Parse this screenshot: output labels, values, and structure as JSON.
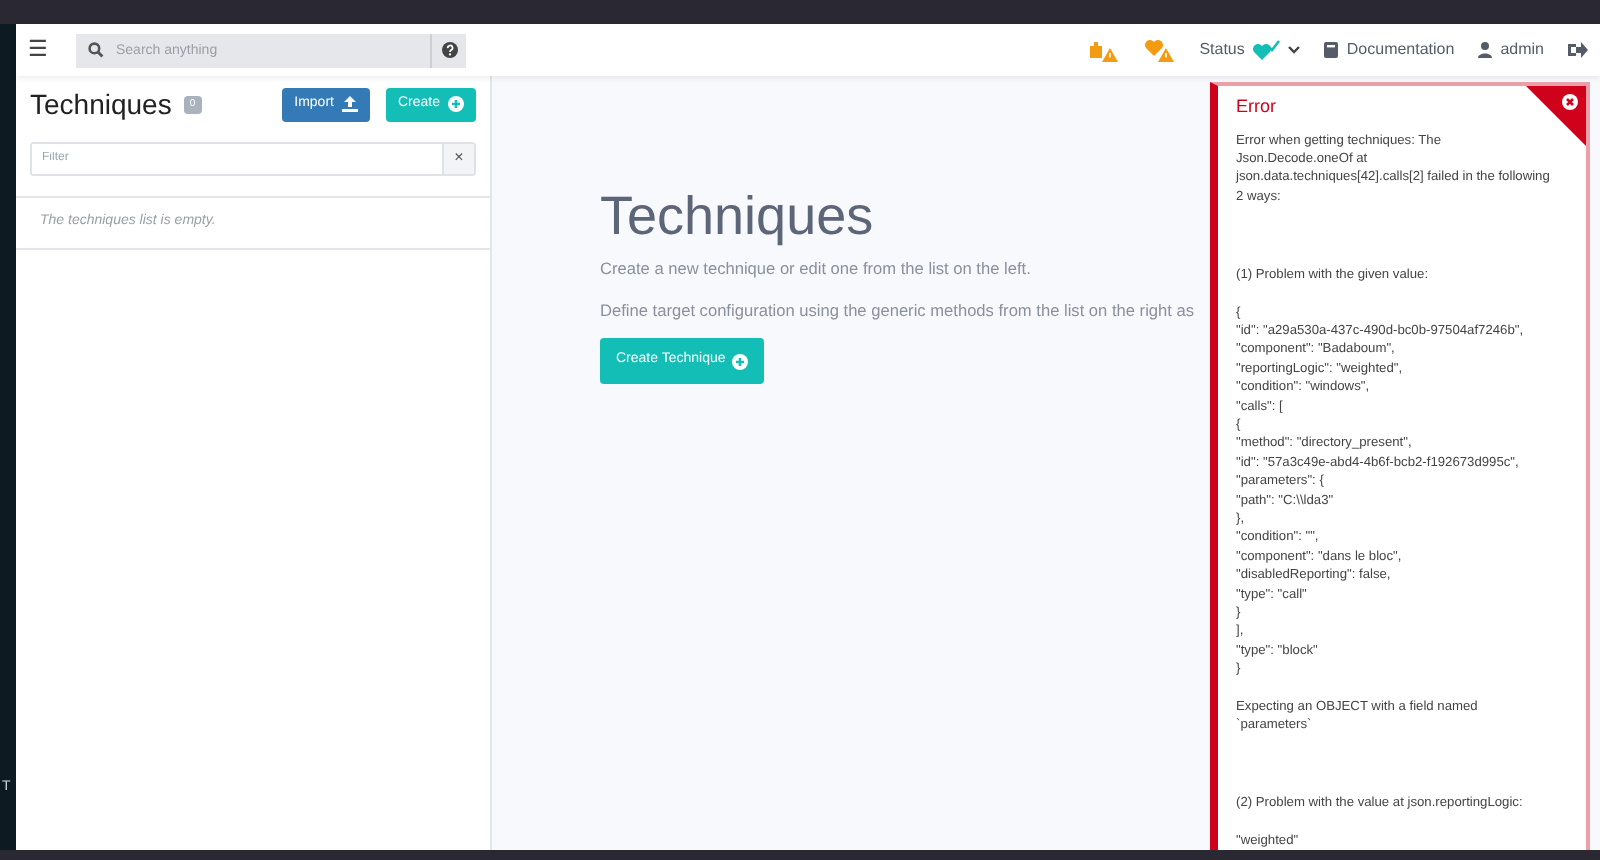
{
  "side_strip": {
    "text": "T"
  },
  "navbar": {
    "menu_icon": "☰",
    "search": {
      "placeholder": "Search anything"
    },
    "status": {
      "label": "Status"
    },
    "documentation": {
      "label": "Documentation"
    },
    "user": {
      "label": "admin"
    }
  },
  "panel": {
    "title": "Techniques",
    "count": "0",
    "buttons": [
      {
        "label": "Import",
        "kind": "import"
      },
      {
        "label": "Create",
        "kind": "create"
      }
    ],
    "filter": {
      "placeholder": "Filter",
      "clear": "×"
    },
    "empty_message": "The techniques list is empty."
  },
  "main": {
    "title": "Techniques",
    "paragraphs": [
      "Create a new technique or edit one from the list on the left.",
      "Define target configuration using the generic methods from the list on the right as"
    ],
    "button": {
      "label": "Create Technique"
    }
  },
  "error": {
    "title": "Error",
    "paragraphs": [
      {
        "kind": "intro",
        "lines": [
          "Error when getting techniques: The",
          "Json.Decode.oneOf at",
          "json.data.techniques[42].calls[2] failed in the following",
          "2 ways:"
        ]
      },
      {
        "kind": "problem",
        "lines": [
          "(1) Problem with the given value:"
        ]
      },
      {
        "kind": "detail",
        "lines": [
          "{",
          "\"id\": \"a29a530a-437c-490d-bc0b-97504af7246b\",",
          "\"component\": \"Badaboum\",",
          "\"reportingLogic\": \"weighted\",",
          "\"condition\": \"windows\",",
          "\"calls\": [",
          "{",
          "\"method\": \"directory_present\",",
          "\"id\": \"57a3c49e-abd4-4b6f-bcb2-f192673d995c\",",
          "\"parameters\": {",
          "\"path\": \"C:\\\\lda3\"",
          "},",
          "\"condition\": \"\",",
          "\"component\": \"dans le bloc\",",
          "\"disabledReporting\": false,",
          "\"type\": \"call\"",
          "}",
          "],",
          "\"type\": \"block\"",
          "}"
        ]
      },
      {
        "kind": "detail",
        "lines": [
          "Expecting an OBJECT with a field named",
          "`parameters`"
        ]
      },
      {
        "kind": "problem",
        "lines": [
          "(2) Problem with the value at json.reportingLogic:"
        ]
      },
      {
        "kind": "detail",
        "lines": [
          "\"weighted\""
        ]
      }
    ]
  }
}
